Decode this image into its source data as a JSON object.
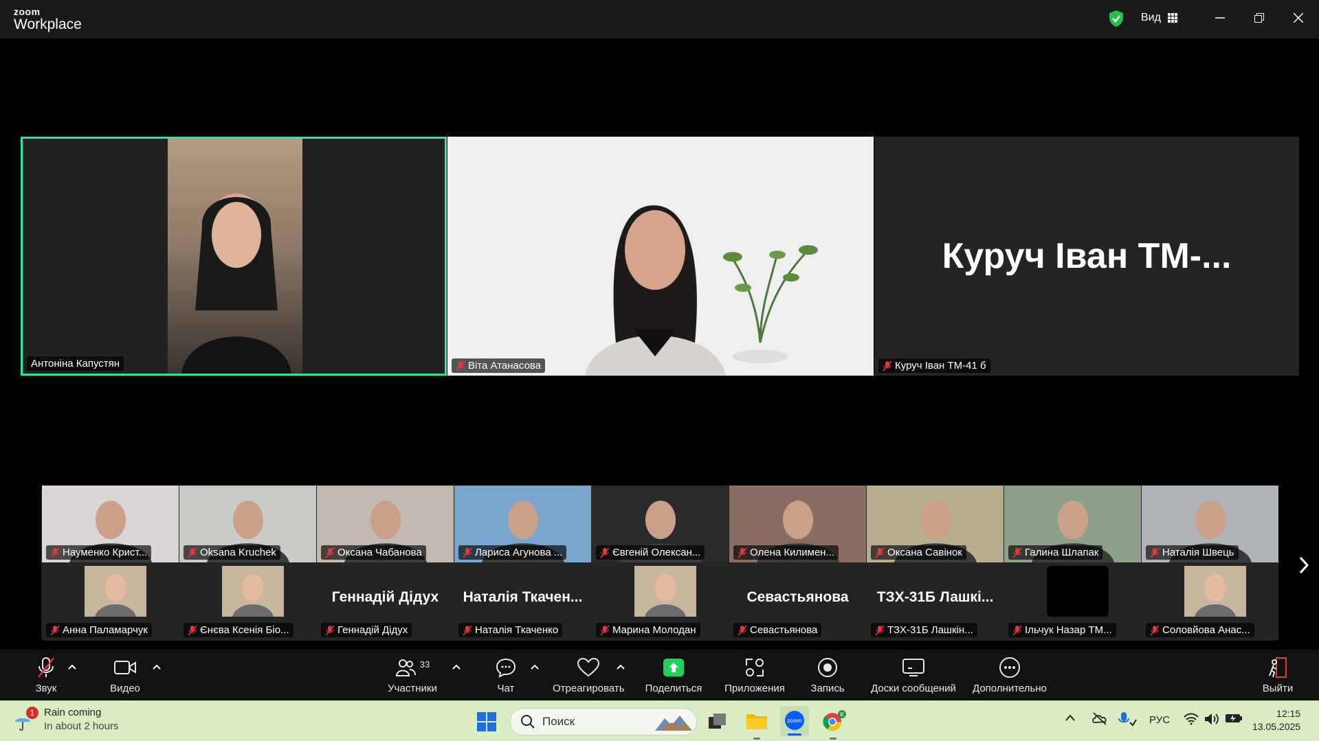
{
  "app": {
    "logo_top": "zoom",
    "logo_bottom": "Workplace",
    "view_label": "Вид"
  },
  "main_tiles": [
    {
      "name": "Антоніна Капустян",
      "muted": false,
      "active_speaker": true
    },
    {
      "name": "Віта Атанасова",
      "muted": true
    },
    {
      "name": "Куруч Іван ТМ-41 б",
      "display_text": "Куруч Іван ТМ-...",
      "muted": true
    }
  ],
  "gallery_row1": [
    {
      "name": "Науменко Крист..."
    },
    {
      "name": "Oksana Kruchek"
    },
    {
      "name": "Оксана Чабанова"
    },
    {
      "name": "Лариса Агунова ..."
    },
    {
      "name": "Євгеній Олексан..."
    },
    {
      "name": "Олена Килимен..."
    },
    {
      "name": "Оксана Савінок"
    },
    {
      "name": "Галина Шлапак"
    },
    {
      "name": "Наталія Швець"
    }
  ],
  "gallery_row2": [
    {
      "name": "Анна Паламарчук",
      "display_text": ""
    },
    {
      "name": "Єнєва Ксенія Біо...",
      "display_text": ""
    },
    {
      "name": "Геннадій Дідух",
      "display_text": "Геннадій Дідух"
    },
    {
      "name": "Наталія Ткаченко",
      "display_text": "Наталія Ткачен..."
    },
    {
      "name": "Марина Молодан",
      "display_text": ""
    },
    {
      "name": "Севастьянова",
      "display_text": "Севастьянова"
    },
    {
      "name": "ТЗХ-31Б Лашкін...",
      "display_text": "ТЗХ-31Б Лашкі..."
    },
    {
      "name": "Ільчук Назар ТМ...",
      "display_text": ""
    },
    {
      "name": "Соловйова Анас...",
      "display_text": ""
    }
  ],
  "toolbar": {
    "audio": "Звук",
    "video": "Видео",
    "participants": "Участники",
    "participants_count": "33",
    "chat": "Чат",
    "react": "Отреагировать",
    "share": "Поделиться",
    "apps": "Приложения",
    "record": "Запись",
    "whiteboards": "Доски сообщений",
    "more": "Дополнительно",
    "leave": "Выйти"
  },
  "taskbar": {
    "weather_badge": "1",
    "weather_title": "Rain coming",
    "weather_sub": "In about 2 hours",
    "search_placeholder": "Поиск",
    "lang": "РУС",
    "time": "12:15",
    "date": "13.05.2025"
  },
  "colors": {
    "active_border": "#2ee59d",
    "share_green": "#1fd15b",
    "muted_red": "#e0383e",
    "leave_red": "#e0383e"
  }
}
